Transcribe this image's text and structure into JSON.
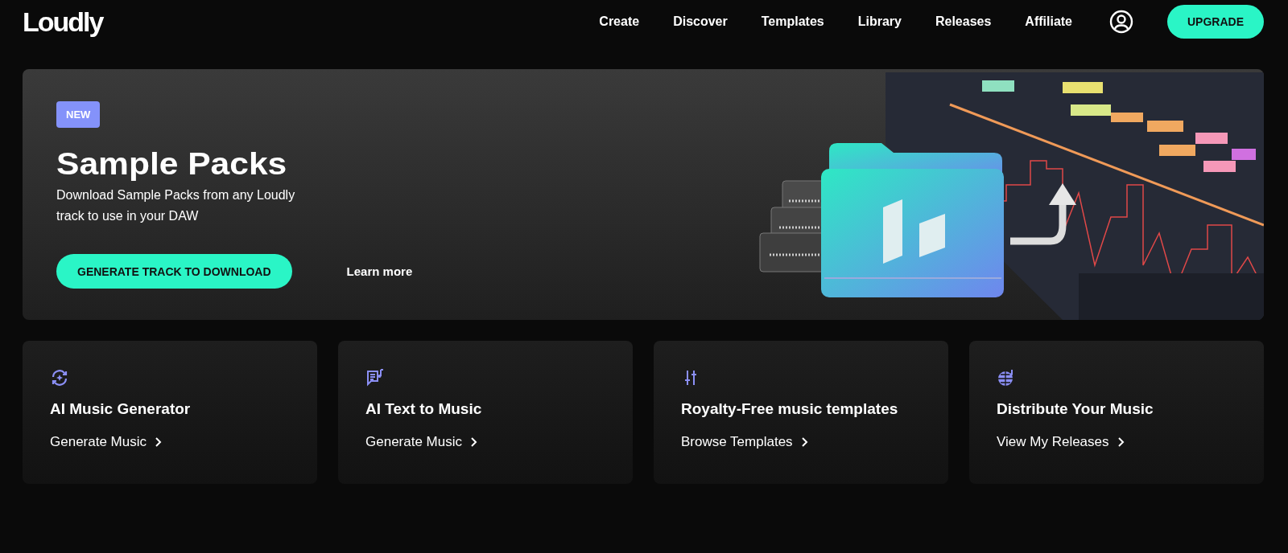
{
  "header": {
    "logo": "Loudly",
    "nav": [
      {
        "label": "Create"
      },
      {
        "label": "Discover"
      },
      {
        "label": "Templates"
      },
      {
        "label": "Library"
      },
      {
        "label": "Releases"
      },
      {
        "label": "Affiliate"
      }
    ],
    "upgrade": "UPGRADE"
  },
  "hero": {
    "badge": "NEW",
    "title": "Sample Packs",
    "description": "Download Sample Packs from any Loudly track to use in your DAW",
    "primary_button": "GENERATE TRACK TO DOWNLOAD",
    "link": "Learn more"
  },
  "cards": [
    {
      "kind": "sync",
      "title": "AI Music Generator",
      "link": "Generate Music"
    },
    {
      "kind": "text-music",
      "title": "AI Text to Music",
      "link": "Generate Music"
    },
    {
      "kind": "sliders",
      "title": "Royalty-Free music templates",
      "link": "Browse Templates"
    },
    {
      "kind": "globe",
      "title": "Distribute Your Music",
      "link": "View My Releases"
    }
  ]
}
